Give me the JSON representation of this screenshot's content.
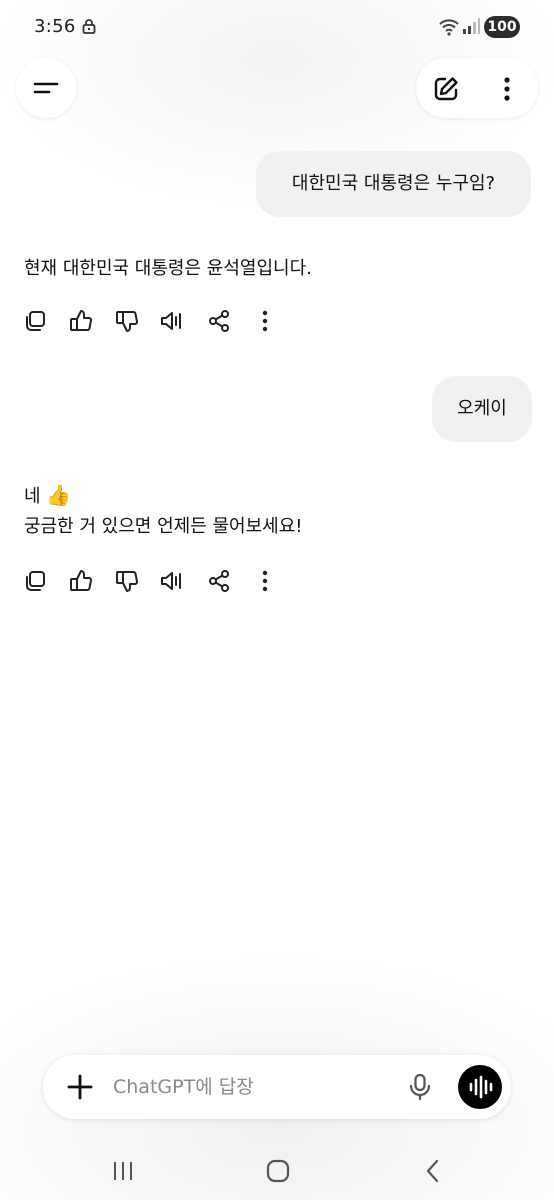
{
  "status_bar": {
    "time": "3:56",
    "battery": "100",
    "icons": [
      "lock-icon",
      "wifi-icon",
      "signal-icon"
    ]
  },
  "header": {
    "icons": [
      "menu-icon",
      "new-chat-icon",
      "more-vertical-icon"
    ]
  },
  "chat": {
    "messages": [
      {
        "role": "user",
        "text": "대한민국 대통령은 누구임?"
      },
      {
        "role": "assistant",
        "lines": [
          "현재 대한민국 대통령은 윤석열입니다."
        ]
      },
      {
        "role": "user",
        "text": "오케이"
      },
      {
        "role": "assistant",
        "lines": [
          "네 ",
          "궁금한 거 있으면 언제든 물어보세요!"
        ],
        "emoji": "👍"
      }
    ],
    "action_icons": [
      "copy-icon",
      "thumbs-up-icon",
      "thumbs-down-icon",
      "read-aloud-icon",
      "share-icon",
      "more-vertical-icon"
    ]
  },
  "composer": {
    "placeholder": "ChatGPT에 답장",
    "icons": [
      "plus-icon",
      "microphone-icon",
      "voice-mode-icon"
    ]
  },
  "nav_bar": {
    "icons": [
      "recent-apps-icon",
      "home-icon",
      "back-icon"
    ]
  },
  "colors": {
    "bubble": "#f1f1f1",
    "text": "#111111",
    "voice_button": "#000000"
  }
}
